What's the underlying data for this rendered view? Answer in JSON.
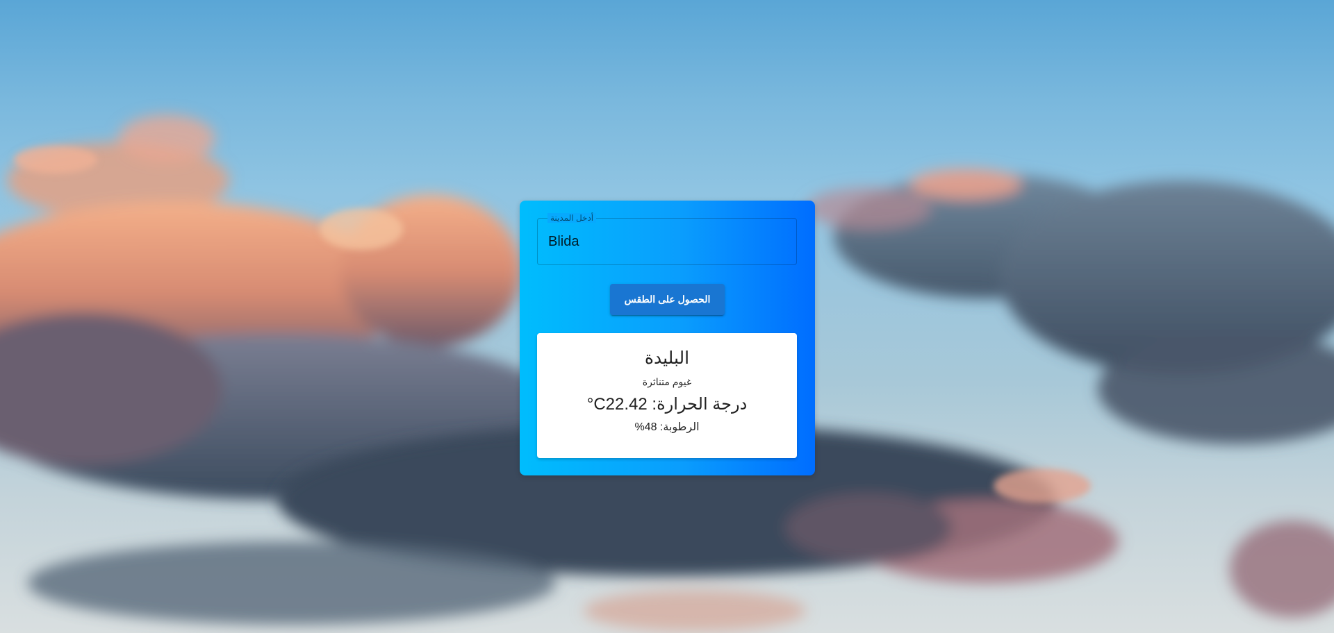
{
  "form": {
    "city_label": "أدخل المدينة",
    "city_value": "Blida",
    "submit_label": "الحصول على الطقس"
  },
  "weather": {
    "city": "البليدة",
    "description": "غيوم متناثرة",
    "temperature_text": "°Cدرجة الحرارة: 22.42",
    "humidity_text": "%الرطوبة: 48"
  },
  "colors": {
    "card_gradient_start": "#00bdfd",
    "card_gradient_end": "#006dff",
    "button": "#1976d2",
    "result_bg": "#ffffff"
  }
}
